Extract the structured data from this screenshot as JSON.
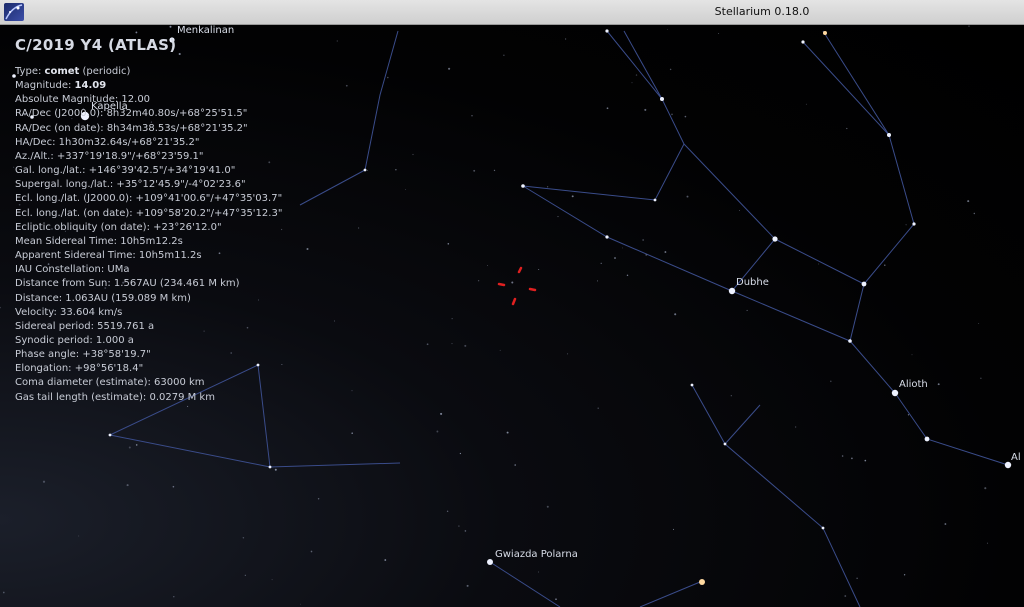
{
  "window": {
    "title": "Stellarium 0.18.0",
    "app_icon": "stellarium-logo-icon"
  },
  "info": {
    "title": "C/2019 Y4 (ATLAS)",
    "type_label": "Type: ",
    "type_value": "comet",
    "type_suffix": " (periodic)",
    "magnitude_label": "Magnitude: ",
    "magnitude_value": "14.09",
    "lines": [
      "Absolute Magnitude: 12.00",
      "RA/Dec (J2000.0): 8h32m40.80s/+68°25'51.5\"",
      "RA/Dec (on date): 8h34m38.53s/+68°21'35.2\"",
      "HA/Dec: 1h30m32.64s/+68°21'35.2\"",
      "Az./Alt.: +337°19'18.9\"/+68°23'59.1\"",
      "Gal. long./lat.: +146°39'42.5\"/+34°19'41.0\"",
      "Supergal. long./lat.: +35°12'45.9\"/-4°02'23.6\"",
      "Ecl. long./lat. (J2000.0): +109°41'00.6\"/+47°35'03.7\"",
      "Ecl. long./lat. (on date): +109°58'20.2\"/+47°35'12.3\"",
      "Ecliptic obliquity (on date): +23°26'12.0\"",
      "Mean Sidereal Time: 10h5m12.2s",
      "Apparent Sidereal Time: 10h5m11.2s",
      "IAU Constellation: UMa",
      "Distance from Sun: 1.567AU (234.461 M km)",
      "Distance: 1.063AU (159.089 M km)",
      "Velocity: 33.604 km/s",
      "Sidereal period: 5519.761 a",
      "Synodic period: 1.000 a",
      "Phase angle: +38°58'19.7\"",
      "Elongation: +98°56'18.4\"",
      "Coma diameter (estimate): 63000 km",
      "Gas tail length (estimate): 0.0279 M km"
    ]
  },
  "star_labels": {
    "menkalinan": "Menkalinan",
    "kapella": "Kapella",
    "dubhe": "Dubhe",
    "alioth": "Alioth",
    "alkaid_partial": "Al",
    "polaris": "Gwiazda Polarna"
  },
  "colors": {
    "constellation_line": "#3a4c8a",
    "star": "#e8eefc",
    "selection_marker": "#e02020",
    "warm_star": "#ffd9a0"
  }
}
